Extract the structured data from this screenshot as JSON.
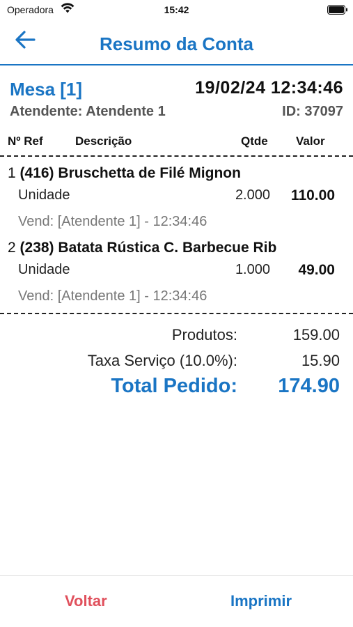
{
  "status_bar": {
    "carrier": "Operadora",
    "time": "15:42"
  },
  "header": {
    "title": "Resumo da Conta",
    "back_icon": "arrow-left-icon"
  },
  "info": {
    "mesa": "Mesa [1]",
    "datetime": "19/02/24 12:34:46",
    "atendente": "Atendente: Atendente 1",
    "order_id": "ID: 37097"
  },
  "columns": {
    "ref": "Nº Ref",
    "descricao": "Descrição",
    "qtde": "Qtde",
    "valor": "Valor"
  },
  "items": [
    {
      "index": "1",
      "code": "(416)",
      "name": "Bruschetta de Filé Mignon",
      "unit": "Unidade",
      "qty": "2.000",
      "value": "110.00",
      "vend": "Vend: [Atendente 1] - 12:34:46"
    },
    {
      "index": "2",
      "code": "(238)",
      "name": "Batata Rústica C. Barbecue Rib",
      "unit": "Unidade",
      "qty": "1.000",
      "value": "49.00",
      "vend": "Vend: [Atendente 1] - 12:34:46"
    }
  ],
  "totals": {
    "produtos_label": "Produtos:",
    "produtos_value": "159.00",
    "taxa_label": "Taxa Serviço (10.0%):",
    "taxa_value": "15.90",
    "total_label": "Total Pedido:",
    "total_value": "174.90"
  },
  "footer": {
    "voltar": "Voltar",
    "imprimir": "Imprimir"
  },
  "colors": {
    "accent": "#1a75c4",
    "danger": "#e0505c"
  }
}
